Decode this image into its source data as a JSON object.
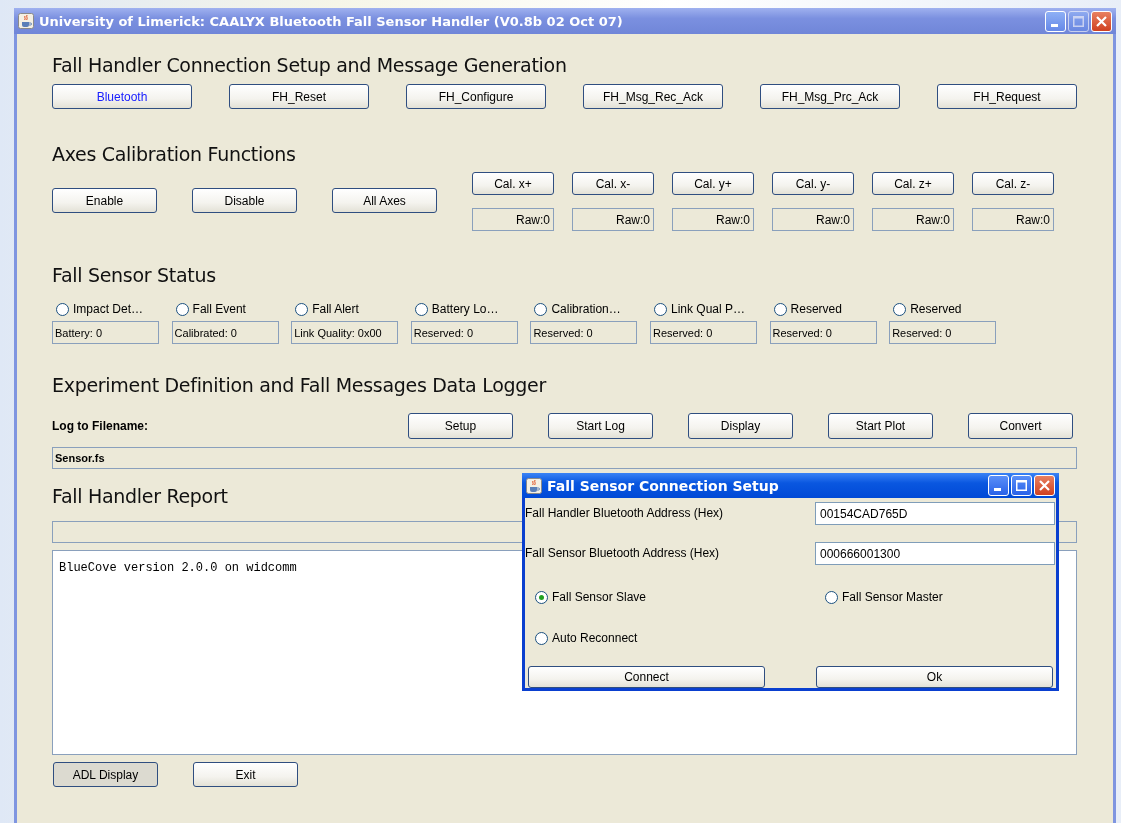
{
  "window": {
    "title": "University of Limerick: CAALYX Bluetooth Fall Sensor Handler (V0.8b 02 Oct 07)"
  },
  "connection_section": {
    "heading": "Fall Handler Connection Setup and Message Generation",
    "buttons": [
      {
        "label": "Bluetooth",
        "highlighted": true
      },
      {
        "label": "FH_Reset",
        "highlighted": false
      },
      {
        "label": "FH_Configure",
        "highlighted": false
      },
      {
        "label": "FH_Msg_Rec_Ack",
        "highlighted": false
      },
      {
        "label": "FH_Msg_Prc_Ack",
        "highlighted": false
      },
      {
        "label": "FH_Request",
        "highlighted": false
      }
    ]
  },
  "calibration_section": {
    "heading": "Axes Calibration Functions",
    "buttons": [
      "Enable",
      "Disable",
      "All Axes"
    ],
    "axes": [
      {
        "label": "Cal. x+",
        "reading": "Raw:0"
      },
      {
        "label": "Cal. x-",
        "reading": "Raw:0"
      },
      {
        "label": "Cal. y+",
        "reading": "Raw:0"
      },
      {
        "label": "Cal. y-",
        "reading": "Raw:0"
      },
      {
        "label": "Cal. z+",
        "reading": "Raw:0"
      },
      {
        "label": "Cal. z-",
        "reading": "Raw:0"
      }
    ]
  },
  "status_section": {
    "heading": "Fall Sensor Status",
    "indicators": [
      {
        "label": "Impact Det…",
        "checked": false
      },
      {
        "label": "Fall Event",
        "checked": false
      },
      {
        "label": "Fall Alert",
        "checked": false
      },
      {
        "label": "Battery Lo…",
        "checked": false
      },
      {
        "label": "Calibration…",
        "checked": false
      },
      {
        "label": "Link Qual P…",
        "checked": false
      },
      {
        "label": "Reserved",
        "checked": false
      },
      {
        "label": "Reserved",
        "checked": false
      }
    ],
    "fields": [
      "Battery: 0",
      "Calibrated: 0",
      "Link Quality: 0x00",
      "Reserved: 0",
      "Reserved: 0",
      "Reserved: 0",
      "Reserved: 0",
      "Reserved: 0"
    ]
  },
  "logger_section": {
    "heading": "Experiment Definition and Fall Messages Data Logger",
    "filename_label": "Log to Filename:",
    "buttons": [
      "Setup",
      "Start Log",
      "Display",
      "Start Plot",
      "Convert"
    ],
    "filename": "Sensor.fs"
  },
  "report_section": {
    "heading": "Fall Handler Report",
    "progress": {
      "level": 0
    },
    "log_text": "BlueCove version 2.0.0 on widcomm",
    "buttons": [
      {
        "label": "ADL Display",
        "pressed": true
      },
      {
        "label": "Exit",
        "pressed": false
      }
    ]
  },
  "dialog": {
    "title": "Fall Sensor Connection Setup",
    "fields": [
      {
        "label": "Fall Handler Bluetooth Address (Hex)",
        "value": "00154CAD765D"
      },
      {
        "label": "Fall Sensor Bluetooth Address (Hex)",
        "value": "000666001300"
      }
    ],
    "options": [
      {
        "label": "Fall Sensor Slave",
        "selected": true
      },
      {
        "label": "Fall Sensor Master",
        "selected": false
      },
      {
        "label": "Auto Reconnect",
        "selected": false
      }
    ],
    "buttons": [
      "Connect",
      "Ok"
    ]
  }
}
